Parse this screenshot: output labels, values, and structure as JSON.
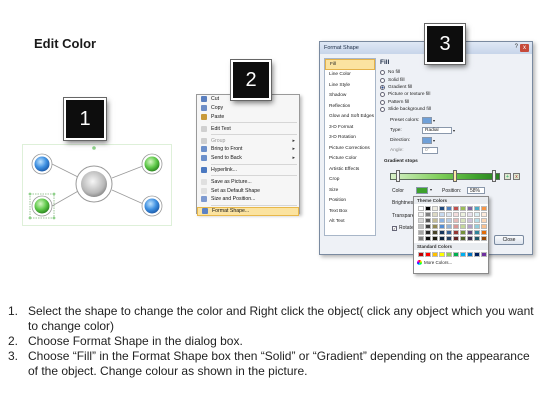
{
  "page": {
    "title": "Edit Color"
  },
  "steps": [
    "1",
    "2",
    "3"
  ],
  "context_menu": {
    "items": [
      {
        "label": "Cut",
        "icon": "scissors-icon",
        "color": "#5a7fbf",
        "disabled": false
      },
      {
        "label": "Copy",
        "icon": "copy-icon",
        "color": "#6d8dc6",
        "disabled": false
      },
      {
        "label": "Paste",
        "icon": "paste-icon",
        "color": "#c89a3a",
        "disabled": false
      },
      {
        "label": "Edit Text",
        "icon": "edit-text-icon",
        "color": "#d0d0d0",
        "disabled": false
      },
      {
        "label": "Group",
        "icon": "group-icon",
        "color": "#cfcfcf",
        "disabled": true,
        "submenu": true
      },
      {
        "label": "Bring to Front",
        "icon": "bring-front-icon",
        "color": "#6b8fca",
        "disabled": false,
        "submenu": true
      },
      {
        "label": "Send to Back",
        "icon": "send-back-icon",
        "color": "#6b8fca",
        "disabled": false,
        "submenu": true
      },
      {
        "label": "Hyperlink...",
        "icon": "hyperlink-icon",
        "color": "#4a78c0",
        "disabled": false
      },
      {
        "label": "Save as Picture...",
        "icon": "save-picture-icon",
        "color": "#e0e0e0",
        "disabled": false
      },
      {
        "label": "Set as Default Shape",
        "icon": "default-shape-icon",
        "color": "#e0e0e0",
        "disabled": false
      },
      {
        "label": "Size and Position...",
        "icon": "size-position-icon",
        "color": "#7e9ad0",
        "disabled": false
      },
      {
        "label": "Format Shape...",
        "icon": "format-shape-icon",
        "color": "#5c82c4",
        "disabled": false,
        "highlight": true
      }
    ]
  },
  "dialog": {
    "title": "Format Shape",
    "help": "?",
    "close_x": "x",
    "nav": [
      "Fill",
      "Line Color",
      "Line Style",
      "Shadow",
      "Reflection",
      "Glow and Soft Edges",
      "3-D Format",
      "3-D Rotation",
      "Picture Corrections",
      "Picture Color",
      "Artistic Effects",
      "Crop",
      "Size",
      "Position",
      "Text Box",
      "Alt Text"
    ],
    "nav_active": 0,
    "pane": {
      "heading": "Fill",
      "options": [
        "No fill",
        "Solid fill",
        "Gradient fill",
        "Picture or texture fill",
        "Pattern fill",
        "Slide background fill"
      ],
      "selected_option": 2,
      "preset_colors_label": "Preset colors:",
      "type_label": "Type:",
      "type_value": "Radial",
      "direction_label": "Direction:",
      "angle_label": "Angle:",
      "angle_value": "0°",
      "gradient_stops_label": "Gradient stops",
      "color_label": "Color",
      "position_label": "Position:",
      "position_value": "58%",
      "brightness_label": "Brightness",
      "transparency_label": "Transparen",
      "rotate_label": "Rotate",
      "close_button": "Close"
    }
  },
  "palette": {
    "theme_label": "Theme Colors",
    "standard_label": "Standard Colors",
    "more_colors": "More Colors...",
    "theme_top": [
      "#ffffff",
      "#000000",
      "#eeece1",
      "#1f497d",
      "#4f81bd",
      "#c0504d",
      "#9bbb59",
      "#8064a2",
      "#4bacc6",
      "#f79646"
    ],
    "theme_shades": [
      [
        "#f2f2f2",
        "#7f7f7f",
        "#ddd9c3",
        "#c6d9f0",
        "#dbe5f1",
        "#f2dcdb",
        "#ebf1dd",
        "#e5e0ec",
        "#dbeef3",
        "#fdeada"
      ],
      [
        "#d8d8d8",
        "#595959",
        "#c4bd97",
        "#8db3e2",
        "#b8cce4",
        "#e5b9b7",
        "#d7e3bc",
        "#ccc1d9",
        "#b7dde8",
        "#fbd5b5"
      ],
      [
        "#bfbfbf",
        "#3f3f3f",
        "#938953",
        "#548dd4",
        "#95b3d7",
        "#d99694",
        "#c3d69b",
        "#b2a2c7",
        "#92cddc",
        "#fac08f"
      ],
      [
        "#a5a5a5",
        "#262626",
        "#494429",
        "#17365d",
        "#366092",
        "#953734",
        "#76923c",
        "#5f497a",
        "#31859b",
        "#e36c09"
      ],
      [
        "#7f7f7f",
        "#0c0c0c",
        "#1d1b10",
        "#0f243e",
        "#244061",
        "#632423",
        "#4f6128",
        "#3f3151",
        "#205867",
        "#974806"
      ]
    ],
    "standard": [
      "#c00000",
      "#ff0000",
      "#ffc000",
      "#ffff00",
      "#92d050",
      "#00b050",
      "#00b0f0",
      "#0070c0",
      "#002060",
      "#7030a0"
    ]
  },
  "instructions": [
    {
      "num": "1.",
      "text": "Select the shape to change the color and Right click the object( click any object which you want to change color)"
    },
    {
      "num": "2.",
      "text": "Choose Format Shape in the dialog box."
    },
    {
      "num": "3.",
      "text": "Choose “Fill” in the Format Shape box then “Solid” or “Gradient” depending on the appearance of the object. Change colour as shown in the picture."
    }
  ],
  "colors": {
    "accent_blue": "#3d8fe0",
    "accent_green": "#3da12c",
    "highlight": "#fbe3a0"
  }
}
